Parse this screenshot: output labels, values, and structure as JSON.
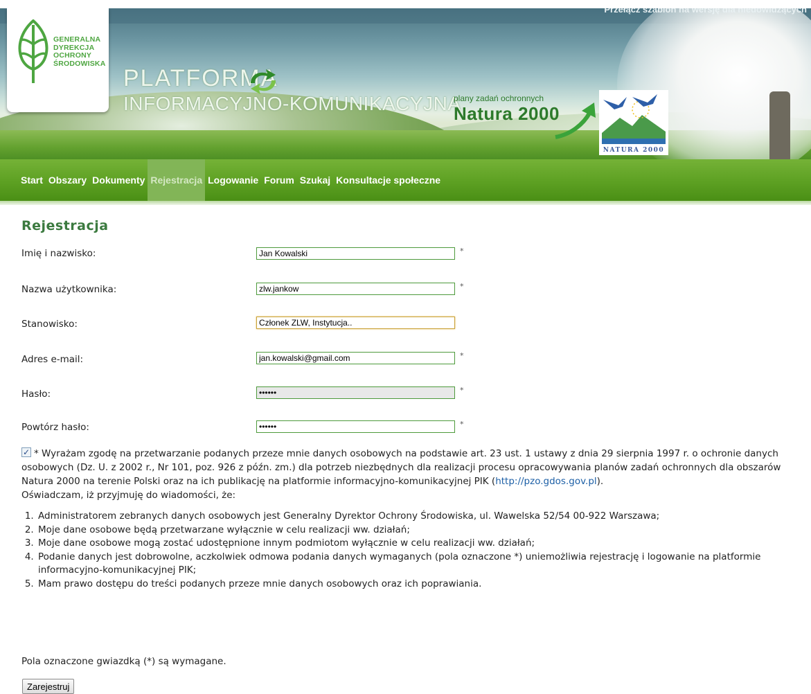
{
  "header": {
    "switch_text": "Przełącz szablon na wersję dla niedowidzących",
    "logo_lines": [
      "GENERALNA",
      "DYREKCJA",
      "OCHRONY",
      "ŚRODOWISKA"
    ],
    "platform_title_1": "PLATFORMA",
    "platform_title_2": "INFORMACYJNO-KOMUNIKACYJNA",
    "natura_small": "plany zadań ochronnych",
    "natura_big": "Natura 2000",
    "natura_logo_caption": "NATURA 2000"
  },
  "nav": {
    "items": [
      "Start",
      "Obszary",
      "Dokumenty",
      "Rejestracja",
      "Logowanie",
      "Forum",
      "Szukaj",
      "Konsultacje społeczne"
    ],
    "active": "Rejestracja"
  },
  "form": {
    "title": "Rejestracja",
    "fields": {
      "fullname": {
        "label": "Imię i nazwisko:",
        "value": "Jan Kowalski",
        "required": "*"
      },
      "username": {
        "label": "Nazwa użytkownika:",
        "value": "zlw.jankow",
        "required": "*"
      },
      "position": {
        "label": "Stanowisko:",
        "value": "Członek ZLW, Instytucja.."
      },
      "email": {
        "label": "Adres e-mail:",
        "value": "jan.kowalski@gmail.com",
        "required": "*"
      },
      "password": {
        "label": "Hasło:",
        "value": "••••••",
        "required": "*"
      },
      "password_repeat": {
        "label": "Powtórz hasło:",
        "value": "••••••",
        "required": "*"
      }
    },
    "consent_checked": true,
    "consent_text_before_link": "* Wyrażam zgodę na przetwarzanie podanych przeze mnie danych osobowych na podstawie art. 23 ust. 1 ustawy z dnia 29 sierpnia 1997 r. o ochronie danych osobowych (Dz. U. z 2002 r., Nr 101, poz. 926 z późn. zm.) dla potrzeb niezbędnych dla realizacji procesu opracowywania planów zadań ochronnych dla obszarów Natura 2000 na terenie Polski oraz na ich publikację na platformie informacyjno-komunikacyjnej PIK (",
    "consent_link": "http://pzo.gdos.gov.pl",
    "consent_text_after_link": ").",
    "statement": "Oświadczam, iż przyjmuję do wiadomości, że:",
    "rules": [
      "Administratorem zebranych danych osobowych jest Generalny Dyrektor Ochrony Środowiska, ul. Wawelska 52/54 00-922 Warszawa;",
      "Moje dane osobowe będą przetwarzane wyłącznie w celu realizacji ww. działań;",
      "Moje dane osobowe mogą zostać udostępnione innym podmiotom wyłącznie w celu realizacji ww. działań;",
      "Podanie danych jest dobrowolne, aczkolwiek odmowa podania danych wymaganych (pola oznaczone *) uniemożliwia rejestrację i logowanie na platformie informacyjno-komunikacyjnej PIK;",
      "Mam prawo dostępu do treści podanych przeze mnie danych osobowych oraz ich poprawiania."
    ],
    "required_note": "Pola oznaczone gwiazdką (*) są wymagane.",
    "submit_label": "Zarejestruj"
  },
  "colors": {
    "nav_green": "#5fa224",
    "nav_active": "#82b557",
    "title_green": "#3b7a3f",
    "field_border": "#4d9a3b",
    "link_blue": "#1c5fa6"
  }
}
